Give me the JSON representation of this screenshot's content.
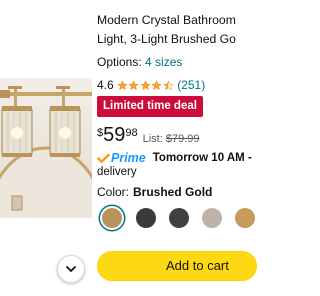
{
  "product": {
    "title_line1": "Modern Crystal Bathroom",
    "title_line2": "Light, 3-Light Brushed Go",
    "options_label": "Options:",
    "options_link": "4 sizes",
    "rating_value": "4.6",
    "rating_stars": 4.5,
    "review_count": "(251)",
    "deal_badge": "Limited time deal",
    "price_currency": "$",
    "price_whole": "59",
    "price_fraction": "98",
    "list_label": "List:",
    "list_price": "$79.99",
    "prime_label": "Prime",
    "delivery_date": "Tomorrow 10 AM -",
    "delivery_word": "delivery",
    "color_label": "Color:",
    "color_value": "Brushed Gold",
    "add_to_cart": "Add to cart"
  },
  "swatches": [
    {
      "name": "Brushed Gold",
      "color": "#b8935a",
      "selected": true
    },
    {
      "name": "Black",
      "color": "#3a3a3a",
      "selected": false
    },
    {
      "name": "Matte Black",
      "color": "#404040",
      "selected": false
    },
    {
      "name": "Brushed Nickel",
      "color": "#bdb3a8",
      "selected": false
    },
    {
      "name": "Gold",
      "color": "#c89a5c",
      "selected": false
    }
  ],
  "icons": {
    "chevron": "chevron-down-icon",
    "prime_check": "prime-check-icon",
    "star": "star-icon"
  },
  "colors": {
    "link": "#007185",
    "deal": "#cc0c39",
    "prime": "#1a98ff",
    "cart_button": "#ffd814",
    "star": "#ffa41c"
  }
}
